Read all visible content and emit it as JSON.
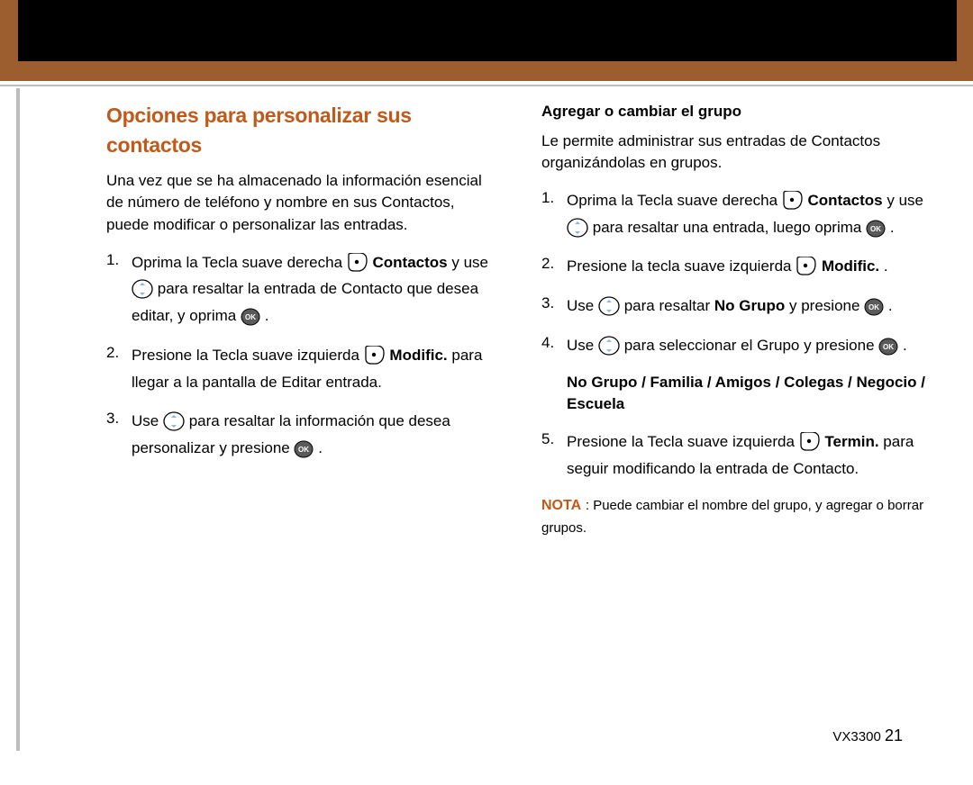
{
  "title": "Opciones para personalizar sus contactos",
  "left": {
    "intro": "Una vez que se ha almacenado la información esencial de número de teléfono y nombre en sus Contactos, puede modificar o personalizar las entradas.",
    "n1": "1.",
    "n2": "2.",
    "n3": "3.",
    "s1a": "Oprima la Tecla suave derecha ",
    "s1b": "Contactos",
    "s1c": " y use ",
    "s1d": " para resaltar la entrada de Contacto que desea editar, y oprima ",
    "s1e": " .",
    "s2a": "Presione la Tecla suave izquierda ",
    "s2b": "Modific.",
    "s2c": " para llegar a la pantalla de Editar entrada.",
    "s3a": "Use ",
    "s3b": " para resaltar la información que desea personalizar y presione ",
    "s3c": " ."
  },
  "right": {
    "subtitle": "Agregar o cambiar el grupo",
    "intro": "Le permite administrar sus entradas de Contactos organizándolas en grupos.",
    "n1": "1.",
    "n2": "2.",
    "n3": "3.",
    "n4": "4.",
    "n5": "5.",
    "s1a": "Oprima la Tecla suave derecha ",
    "s1b": "Contactos",
    "s1c": " y use ",
    "s1d": " para resaltar una entrada, luego oprima ",
    "s1e": " .",
    "s2a": "Presione la tecla suave izquierda ",
    "s2b": "Modific.",
    "s2c": " .",
    "s3a": "Use ",
    "s3b": " para resaltar ",
    "s3c": "No Grupo",
    "s3d": " y presione ",
    "s3e": " .",
    "s4a": "Use ",
    "s4b": " para seleccionar el Grupo y presione ",
    "s4c": " .",
    "groups": "No Grupo / Familia / Amigos / Colegas / Negocio / Escuela",
    "s5a": "Presione la Tecla suave izquierda ",
    "s5b": "Termin.",
    "s5c": " para seguir modificando la entrada de Contacto.",
    "note_label": "NOTA",
    "note_text": " : Puede cambiar el nombre del grupo, y agregar o borrar grupos."
  },
  "footer": {
    "model": "VX3300",
    "page": "21"
  }
}
